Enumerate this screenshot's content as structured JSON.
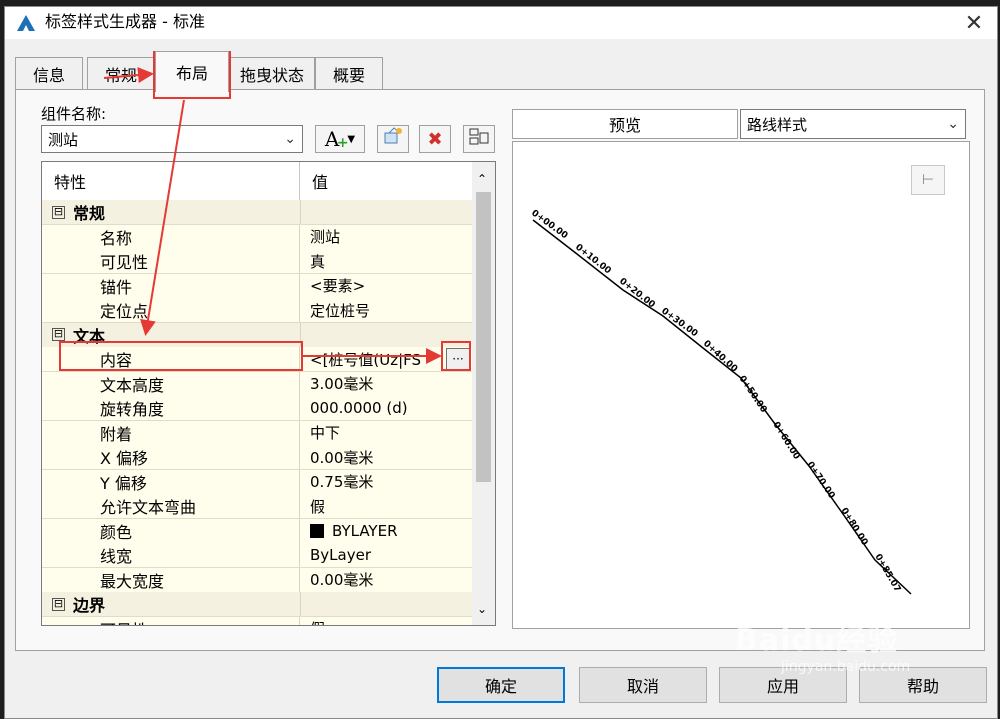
{
  "window": {
    "title": "标签样式生成器 - 标准",
    "close_glyph": "✕"
  },
  "tabs": [
    {
      "label": "信息",
      "active": false
    },
    {
      "label": "常规",
      "active": false
    },
    {
      "label": "布局",
      "active": true
    },
    {
      "label": "拖曳状态",
      "active": false
    },
    {
      "label": "概要",
      "active": false
    }
  ],
  "component": {
    "label": "组件名称:",
    "value": "测站"
  },
  "toolbar": {
    "icons": [
      "add-component-icon",
      "copy-component-icon",
      "delete-component-icon",
      "component-order-icon"
    ],
    "add_glyph": "A",
    "delete_glyph": "✖"
  },
  "grid": {
    "headers": {
      "property": "特性",
      "value": "值"
    },
    "rows": [
      {
        "type": "category",
        "label": "常规",
        "expander": "⊟"
      },
      {
        "type": "prop",
        "prop": "名称",
        "value": "测站"
      },
      {
        "type": "prop",
        "prop": "可见性",
        "value": "真"
      },
      {
        "type": "prop",
        "prop": "锚件",
        "value": "<要素>"
      },
      {
        "type": "prop",
        "prop": "定位点",
        "value": "定位桩号"
      },
      {
        "type": "category",
        "label": "文本",
        "expander": "⊟"
      },
      {
        "type": "prop",
        "prop": "内容",
        "value": "<[桩号值(Uz|FS"
      },
      {
        "type": "prop",
        "prop": "文本高度",
        "value": "3.00毫米"
      },
      {
        "type": "prop",
        "prop": "旋转角度",
        "value": "000.0000 (d)"
      },
      {
        "type": "prop",
        "prop": "附着",
        "value": "中下"
      },
      {
        "type": "prop",
        "prop": "X 偏移",
        "value": "0.00毫米"
      },
      {
        "type": "prop",
        "prop": "Y 偏移",
        "value": "0.75毫米"
      },
      {
        "type": "prop",
        "prop": "允许文本弯曲",
        "value": "假"
      },
      {
        "type": "prop",
        "prop": "颜色",
        "value": "BYLAYER",
        "swatch": "#000000"
      },
      {
        "type": "prop",
        "prop": "线宽",
        "value": "ByLayer"
      },
      {
        "type": "prop",
        "prop": "最大宽度",
        "value": "0.00毫米"
      },
      {
        "type": "category",
        "label": "边界",
        "expander": "⊟"
      },
      {
        "type": "prop",
        "prop": "可见性",
        "value": "假"
      }
    ],
    "ellipsis_glyph": "···"
  },
  "preview": {
    "tab_label": "预览",
    "style_select": "路线样式",
    "stations": [
      "0+00.00",
      "0+10.00",
      "0+20.00",
      "0+30.00",
      "0+40.00",
      "0+50.00",
      "0+60.00",
      "0+70.00",
      "0+80.00",
      "0+85.07"
    ]
  },
  "buttons": {
    "ok": "确定",
    "cancel": "取消",
    "apply": "应用",
    "help": "帮助"
  },
  "watermark": {
    "brand": "Baidu经验",
    "url": "jingyan.baidu.com"
  },
  "colors": {
    "highlight_red": "#e53935",
    "grid_bg": "#fffdeb",
    "default_button_border": "#0078d7"
  }
}
